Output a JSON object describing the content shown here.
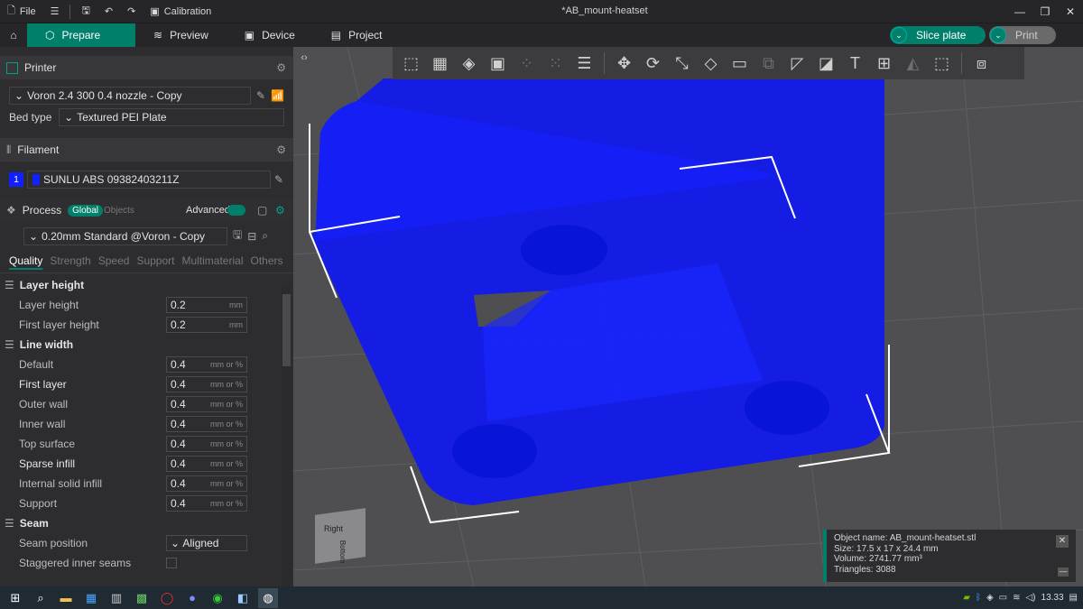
{
  "titlebar": {
    "file_label": "File",
    "calibration_label": "Calibration",
    "title": "*AB_mount-heatset"
  },
  "tabs": {
    "prepare": "Prepare",
    "preview": "Preview",
    "device": "Device",
    "project": "Project",
    "slice_plate": "Slice plate",
    "print": "Print"
  },
  "printer": {
    "header": "Printer",
    "name": "Voron 2.4 300 0.4 nozzle - Copy",
    "bed_type_label": "Bed type",
    "bed_type": "Textured PEI Plate"
  },
  "filament": {
    "header": "Filament",
    "index": "1",
    "name": "SUNLU ABS 09382403211Z",
    "color": "#0010ff"
  },
  "process": {
    "header": "Process",
    "global": "Global",
    "objects": "Objects",
    "advanced": "Advanced",
    "preset": "0.20mm Standard @Voron - Copy",
    "tabs": [
      "Quality",
      "Strength",
      "Speed",
      "Support",
      "Multimaterial",
      "Others"
    ]
  },
  "groups": {
    "layer_height": {
      "title": "Layer height",
      "params": [
        {
          "label": "Layer height",
          "value": "0.2",
          "unit": "mm"
        },
        {
          "label": "First layer height",
          "value": "0.2",
          "unit": "mm"
        }
      ]
    },
    "line_width": {
      "title": "Line width",
      "params": [
        {
          "label": "Default",
          "value": "0.4",
          "unit": "mm or %"
        },
        {
          "label": "First layer",
          "value": "0.4",
          "unit": "mm or %"
        },
        {
          "label": "Outer wall",
          "value": "0.4",
          "unit": "mm or %"
        },
        {
          "label": "Inner wall",
          "value": "0.4",
          "unit": "mm or %"
        },
        {
          "label": "Top surface",
          "value": "0.4",
          "unit": "mm or %"
        },
        {
          "label": "Sparse infill",
          "value": "0.4",
          "unit": "mm or %"
        },
        {
          "label": "Internal solid infill",
          "value": "0.4",
          "unit": "mm or %"
        },
        {
          "label": "Support",
          "value": "0.4",
          "unit": "mm or %"
        }
      ]
    },
    "seam": {
      "title": "Seam",
      "seam_position_label": "Seam position",
      "seam_position_value": "Aligned",
      "staggered_label": "Staggered inner seams"
    }
  },
  "object_info": {
    "name": "Object name: AB_mount-heatset.stl",
    "size": "Size: 17.5 x 17 x 24.4 mm",
    "volume": "Volume: 2741.77 mm³",
    "triangles": "Triangles: 3088"
  },
  "view_cube": {
    "right": "Right",
    "bottom": "Bottom"
  },
  "tray": {
    "time": "13.33"
  },
  "colors": {
    "accent": "#00806a",
    "model": "#0a14ff"
  }
}
